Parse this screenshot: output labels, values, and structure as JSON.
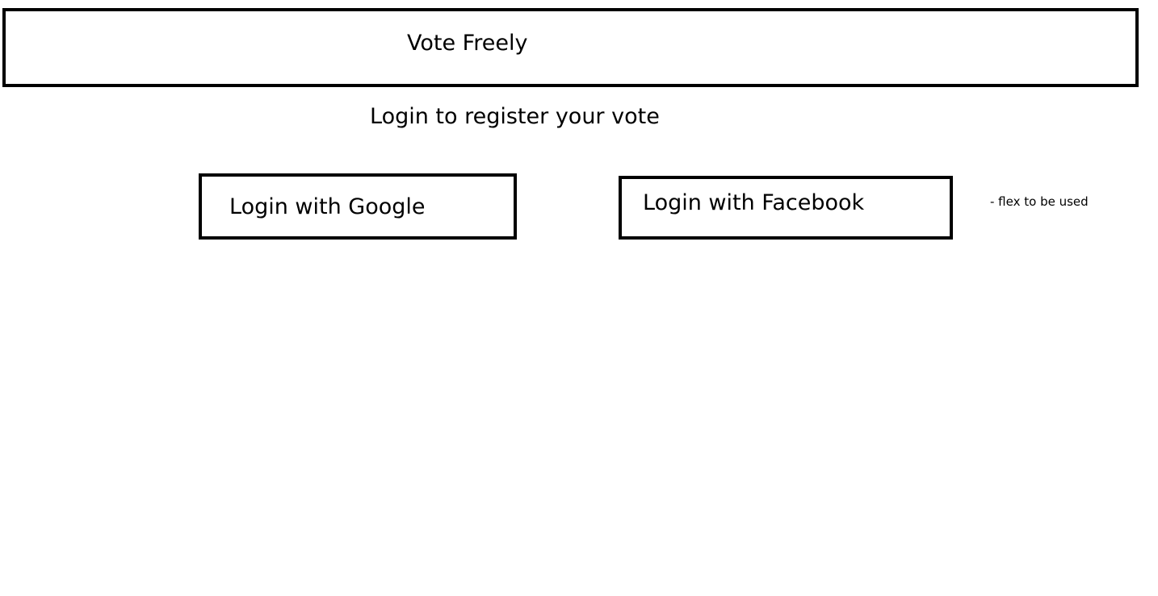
{
  "header": {
    "title": "Vote Freely"
  },
  "main": {
    "subtitle": "Login to register your vote",
    "buttons": {
      "google_label": "Login with Google",
      "facebook_label": "Login with Facebook"
    },
    "note": "- flex to be used"
  },
  "colors": {
    "border": "#000000",
    "background": "#ffffff",
    "text": "#000000"
  }
}
